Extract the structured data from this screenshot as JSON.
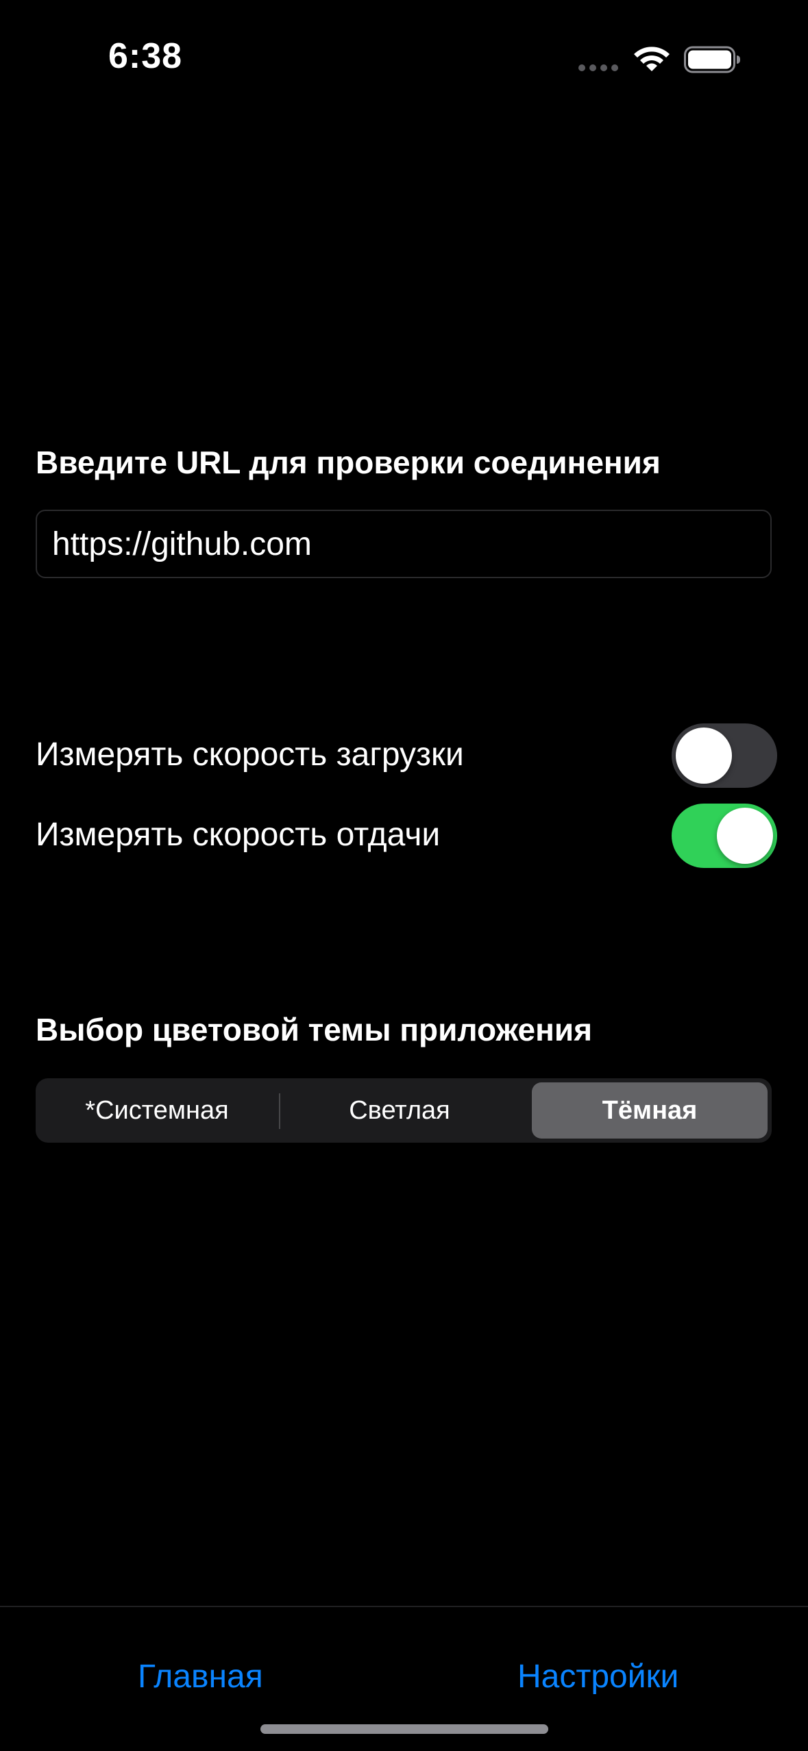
{
  "status_bar": {
    "time": "6:38",
    "icons": [
      "signal-dots-icon",
      "wifi-icon",
      "battery-icon"
    ]
  },
  "url_section": {
    "title": "Введите URL для проверки соединения",
    "input_value": "https://github.com"
  },
  "speed_options": [
    {
      "label": "Измерять скорость загрузки",
      "enabled": false
    },
    {
      "label": "Измерять скорость отдачи",
      "enabled": true
    }
  ],
  "theme_section": {
    "title": "Выбор цветовой темы приложения",
    "options": [
      "*Системная",
      "Светлая",
      "Тёмная"
    ],
    "selected": "Тёмная"
  },
  "tab_bar": {
    "items": [
      {
        "label": "Главная"
      },
      {
        "label": "Настройки"
      }
    ]
  },
  "colors": {
    "background": "#000000",
    "accent": "#0a84ff",
    "toggle_on": "#30d158",
    "toggle_off": "#39393d",
    "segment_selected": "#636366"
  }
}
